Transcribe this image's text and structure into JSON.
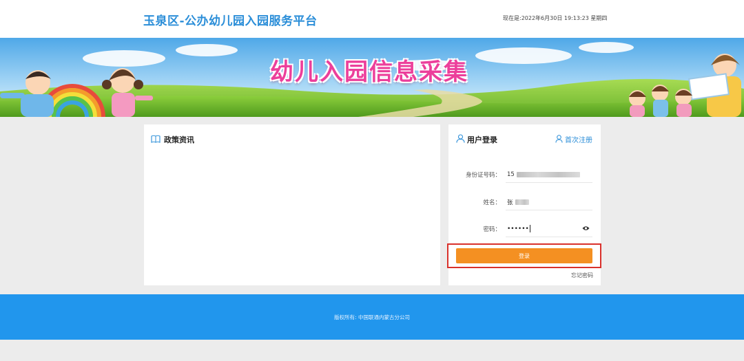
{
  "header": {
    "site_title": "玉泉区-公办幼儿园入园服务平台",
    "datetime": "现在是:2022年6月30日 19:13:23 星期四"
  },
  "banner": {
    "title": "幼儿入园信息采集"
  },
  "policy": {
    "title": "政策资讯"
  },
  "login": {
    "title": "用户登录",
    "register_label": "首次注册",
    "id_label": "身份证号码：",
    "id_value_visible": "15",
    "name_label": "姓名：",
    "name_value_visible": "张",
    "password_label": "密码：",
    "password_value": "••••••",
    "submit_label": "登录",
    "forgot_label": "忘记密码"
  },
  "footer": {
    "copyright": "版权所有: 中国联通内蒙古分公司"
  },
  "colors": {
    "accent_blue": "#2196ed",
    "title_blue": "#2b8ed8",
    "login_orange": "#f49022",
    "highlight_red": "#d9302a",
    "banner_pink": "#ec3f9b"
  },
  "icons": [
    "book-icon",
    "user-icon",
    "user-outline-icon",
    "eye-icon"
  ]
}
